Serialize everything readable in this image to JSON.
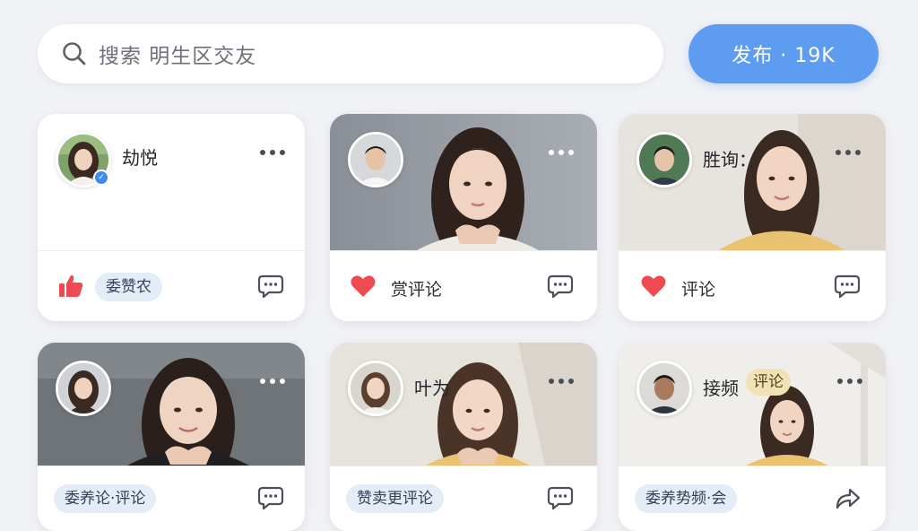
{
  "search": {
    "placeholder": "搜索 明生区交友"
  },
  "header": {
    "publish_label": "发布 · 19K"
  },
  "colors": {
    "accent": "#5e9cf2",
    "like_red": "#ee4a52",
    "pill_blue": "#e4ecf8",
    "pill_gold": "#f1e2b6"
  },
  "cards": [
    {
      "name": "劫悦",
      "verified": true,
      "reaction_icon": "thumbs-up-icon",
      "reaction_label": "委赞农",
      "action_icon": "comment-icon"
    },
    {
      "name": "",
      "reaction_icon": "heart-icon",
      "reaction_label": "赏评论",
      "action_icon": "comment-icon"
    },
    {
      "name": "胜询：",
      "reaction_icon": "heart-icon",
      "reaction_label": "评论",
      "action_icon": "comment-icon"
    },
    {
      "name": "",
      "reaction_label": "委养论·评论",
      "action_icon": "comment-icon"
    },
    {
      "name": "叶为",
      "reaction_label": "赞卖更评论",
      "action_icon": "comment-icon"
    },
    {
      "name": "接频",
      "badge": "评论",
      "reaction_label": "委养势频·会",
      "action_icon": "share-icon"
    }
  ]
}
